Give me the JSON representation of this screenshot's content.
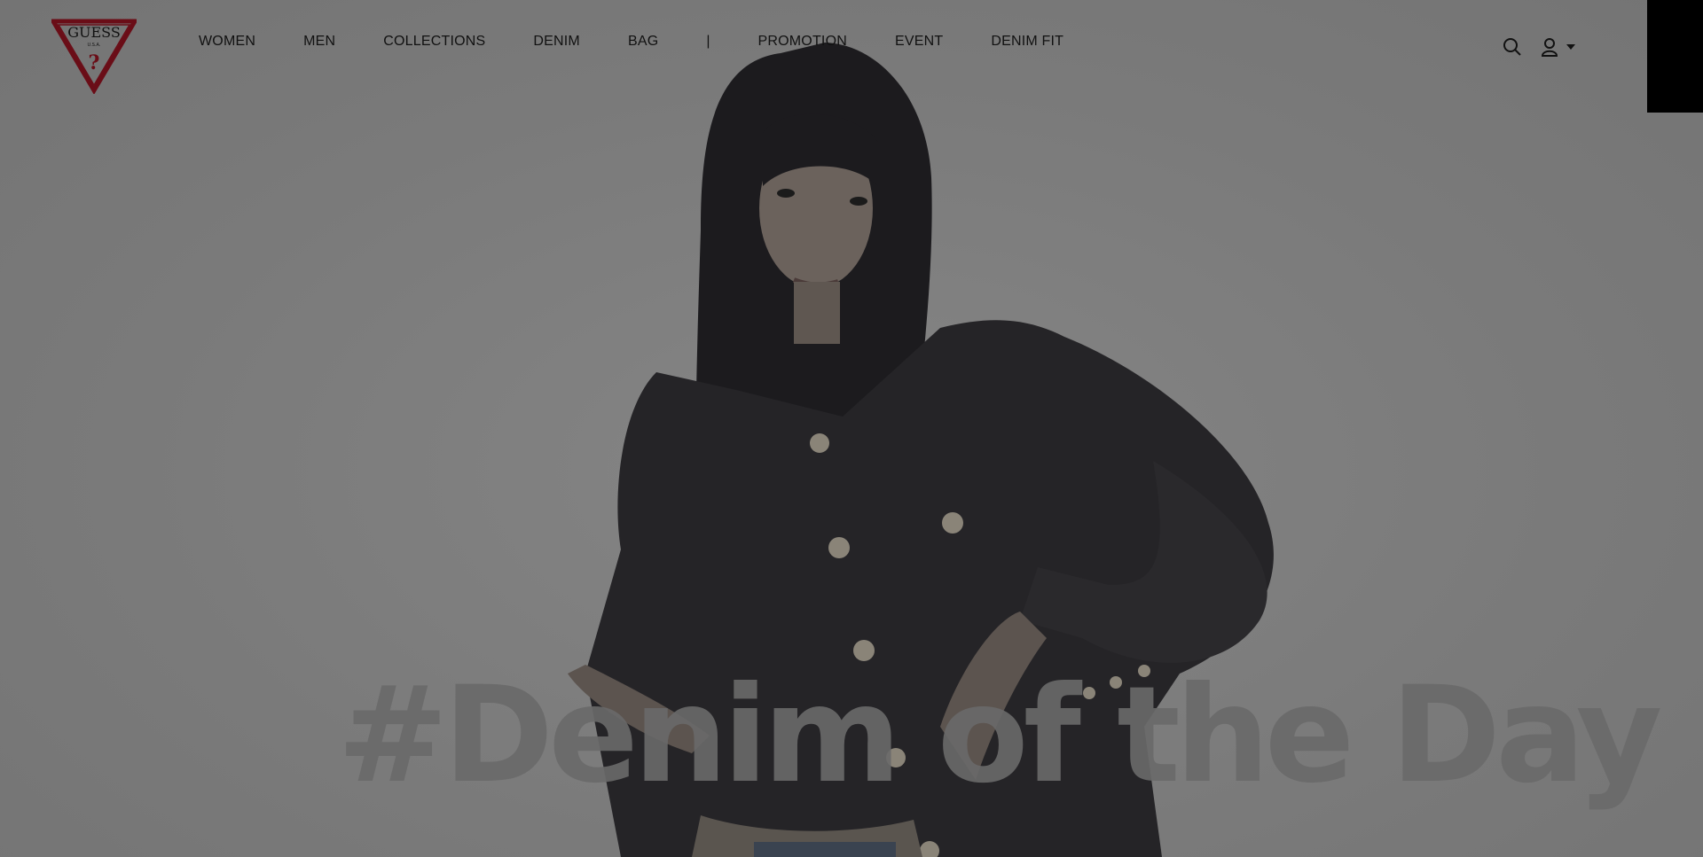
{
  "brand": {
    "logo_text": "GUESS",
    "logo_sub": "U.S.A.",
    "accent_color": "#c8102e"
  },
  "nav": {
    "items": [
      {
        "label": "WOMEN"
      },
      {
        "label": "MEN"
      },
      {
        "label": "COLLECTIONS"
      },
      {
        "label": "DENIM"
      },
      {
        "label": "BAG"
      }
    ],
    "separator": "|",
    "items2": [
      {
        "label": "PROMOTION"
      },
      {
        "label": "EVENT"
      },
      {
        "label": "DENIM FIT"
      }
    ]
  },
  "utils": {
    "icons": [
      "search-icon",
      "user-icon",
      "caret-down-icon"
    ]
  },
  "hero": {
    "headline": "#Denim of the Day",
    "overlay_color": "#7d7d7d"
  }
}
